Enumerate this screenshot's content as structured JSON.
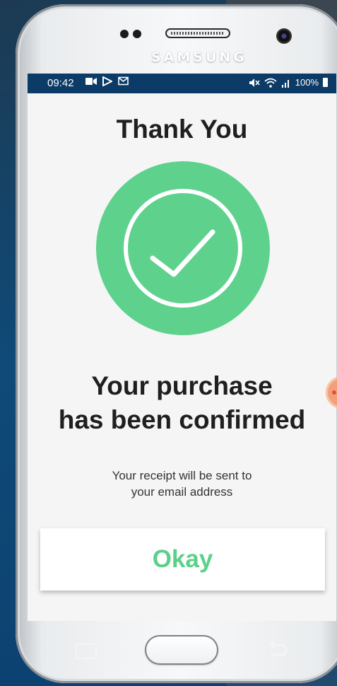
{
  "device": {
    "brand": "SAMSUNG"
  },
  "status_bar": {
    "time": "09:42",
    "battery": "100%"
  },
  "screen": {
    "title": "Thank You",
    "heading_line1": "Your purchase",
    "heading_line2": "has been confirmed",
    "sub_line1": "Your receipt will be sent to",
    "sub_line2": "your email address",
    "okay_label": "Okay"
  },
  "colors": {
    "accent_green": "#5cd089",
    "status_bar_bg": "#0c3b68",
    "screen_bg": "#f5f5f5"
  },
  "icons": {
    "status_left": [
      "video-icon",
      "play-store-icon",
      "mail-icon"
    ],
    "status_right": [
      "mute-icon",
      "wifi-icon",
      "signal-icon",
      "battery-icon"
    ],
    "hero": "check-circle-icon",
    "nav": [
      "recent-apps-icon",
      "home-button",
      "back-icon"
    ]
  }
}
